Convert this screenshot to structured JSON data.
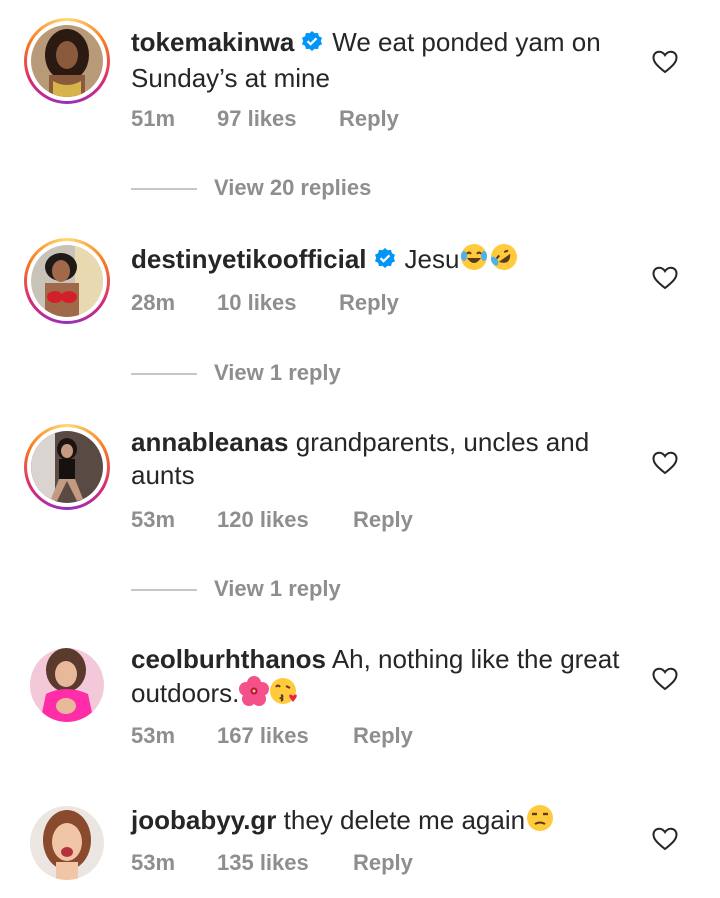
{
  "comments": [
    {
      "username": "tokemakinwa",
      "verified": true,
      "text": "We eat ponded yam on Sunday’s at mine",
      "time": "51m",
      "likes": "97 likes",
      "reply": "Reply",
      "view_replies": "View 20 replies",
      "has_story_ring": true
    },
    {
      "username": "destinyetikoofficial",
      "verified": true,
      "text": "Jesu",
      "emojis": [
        "face-with-tears-of-joy",
        "rolling-on-floor-laughing"
      ],
      "time": "28m",
      "likes": "10 likes",
      "reply": "Reply",
      "view_replies": "View 1 reply",
      "has_story_ring": true
    },
    {
      "username": "annableanas",
      "verified": false,
      "text": "grandparents, uncles and aunts",
      "time": "53m",
      "likes": "120 likes",
      "reply": "Reply",
      "view_replies": "View 1 reply",
      "has_story_ring": true
    },
    {
      "username": "ceolburhthanos",
      "verified": false,
      "text": "Ah, nothing like the great outdoors.",
      "emojis": [
        "hibiscus",
        "face-blowing-a-kiss"
      ],
      "time": "53m",
      "likes": "167 likes",
      "reply": "Reply",
      "has_story_ring": false
    },
    {
      "username": "joobabyy.gr",
      "verified": false,
      "text": "they delete me again",
      "emojis": [
        "unamused-face"
      ],
      "time": "53m",
      "likes": "135 likes",
      "reply": "Reply",
      "has_story_ring": false
    }
  ],
  "icons": {
    "like": "heart-outline-icon",
    "verified": "verified-badge-icon"
  },
  "colors": {
    "verified_blue": "#0095f6",
    "secondary_text": "#8e8e8e",
    "primary_text": "#262626"
  }
}
